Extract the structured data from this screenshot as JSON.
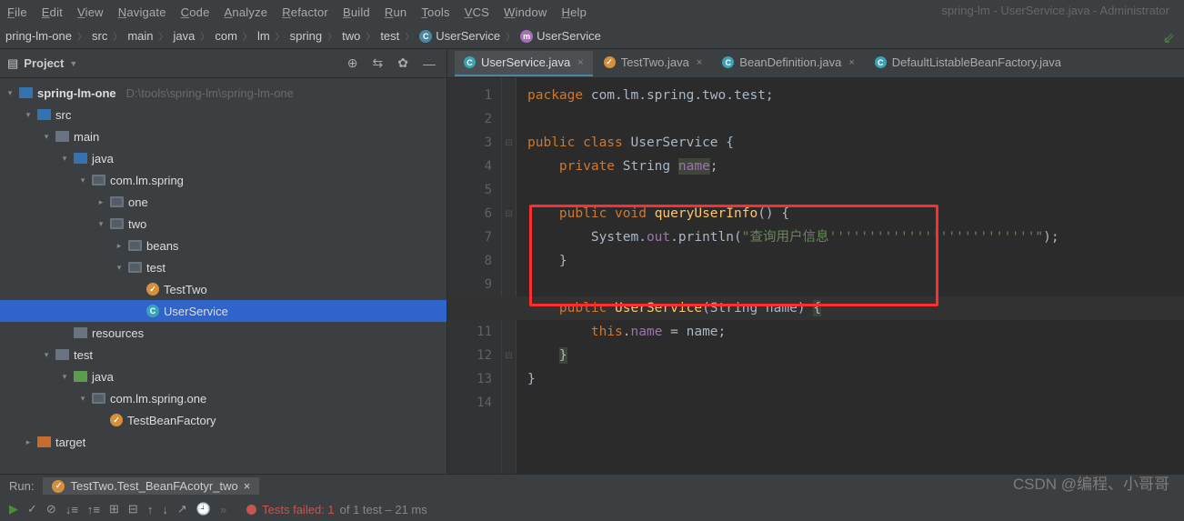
{
  "title": "spring-lm - UserService.java - Administrator",
  "menu": [
    "File",
    "Edit",
    "View",
    "Navigate",
    "Code",
    "Analyze",
    "Refactor",
    "Build",
    "Run",
    "Tools",
    "VCS",
    "Window",
    "Help"
  ],
  "breadcrumbs": [
    {
      "label": "pring-lm-one"
    },
    {
      "label": "src"
    },
    {
      "label": "main"
    },
    {
      "label": "java"
    },
    {
      "label": "com"
    },
    {
      "label": "lm"
    },
    {
      "label": "spring"
    },
    {
      "label": "two"
    },
    {
      "label": "test"
    },
    {
      "label": "UserService",
      "icon": "cyan"
    },
    {
      "label": "UserService",
      "icon": "purple"
    }
  ],
  "sidebar": {
    "title": "Project",
    "root": {
      "label": "spring-lm-one",
      "path": "D:\\tools\\spring-lm\\spring-lm-one"
    },
    "tree": [
      {
        "indent": 1,
        "arrow": "d",
        "icon": "folder-blue",
        "label": "src"
      },
      {
        "indent": 2,
        "arrow": "d",
        "icon": "folder",
        "label": "main"
      },
      {
        "indent": 3,
        "arrow": "d",
        "icon": "folder-blue",
        "label": "java"
      },
      {
        "indent": 4,
        "arrow": "d",
        "icon": "folder-pkg",
        "label": "com.lm.spring"
      },
      {
        "indent": 5,
        "arrow": "r",
        "icon": "folder-pkg",
        "label": "one"
      },
      {
        "indent": 5,
        "arrow": "d",
        "icon": "folder-pkg",
        "label": "two"
      },
      {
        "indent": 6,
        "arrow": "r",
        "icon": "folder-pkg",
        "label": "beans"
      },
      {
        "indent": 6,
        "arrow": "d",
        "icon": "folder-pkg",
        "label": "test"
      },
      {
        "indent": 7,
        "arrow": "",
        "icon": "file-orange",
        "label": "TestTwo"
      },
      {
        "indent": 7,
        "arrow": "",
        "icon": "file-cyan",
        "label": "UserService",
        "selected": true
      },
      {
        "indent": 3,
        "arrow": "",
        "icon": "folder",
        "label": "resources"
      },
      {
        "indent": 2,
        "arrow": "d",
        "icon": "folder",
        "label": "test"
      },
      {
        "indent": 3,
        "arrow": "d",
        "icon": "folder-green",
        "label": "java"
      },
      {
        "indent": 4,
        "arrow": "d",
        "icon": "folder-pkg",
        "label": "com.lm.spring.one"
      },
      {
        "indent": 5,
        "arrow": "",
        "icon": "file-orange",
        "label": "TestBeanFactory"
      },
      {
        "indent": 1,
        "arrow": "r",
        "icon": "folder-orange",
        "label": "target"
      }
    ]
  },
  "tabs": [
    {
      "label": "UserService.java",
      "active": true,
      "icon": "cyan"
    },
    {
      "label": "TestTwo.java",
      "active": false,
      "icon": "orange"
    },
    {
      "label": "BeanDefinition.java",
      "active": false,
      "icon": "cyan"
    },
    {
      "label": "DefaultListableBeanFactory.java",
      "active": false,
      "icon": "cyan",
      "noclose": true
    }
  ],
  "code": {
    "lines": [
      {
        "tokens": [
          {
            "t": "package ",
            "c": "kw"
          },
          {
            "t": "com.lm.spring.two.test;",
            "c": "typ"
          }
        ]
      },
      {
        "tokens": []
      },
      {
        "tokens": [
          {
            "t": "public class ",
            "c": "kw"
          },
          {
            "t": "UserService ",
            "c": "typ"
          },
          {
            "t": "{",
            "c": "typ"
          }
        ]
      },
      {
        "tokens": [
          {
            "t": "    ",
            "c": ""
          },
          {
            "t": "private ",
            "c": "kw"
          },
          {
            "t": "String ",
            "c": "typ"
          },
          {
            "t": "name",
            "c": "high fld"
          },
          {
            "t": ";",
            "c": "typ"
          }
        ]
      },
      {
        "tokens": []
      },
      {
        "tokens": [
          {
            "t": "    ",
            "c": ""
          },
          {
            "t": "public void ",
            "c": "kw"
          },
          {
            "t": "queryUserInfo",
            "c": "id"
          },
          {
            "t": "() {",
            "c": "typ"
          }
        ]
      },
      {
        "tokens": [
          {
            "t": "        System.",
            "c": "typ"
          },
          {
            "t": "out",
            "c": "fld"
          },
          {
            "t": ".println(",
            "c": "typ"
          },
          {
            "t": "\"查询用户信息''''''''''''''''''''''''''\"",
            "c": "str"
          },
          {
            "t": ");",
            "c": "typ"
          }
        ]
      },
      {
        "tokens": [
          {
            "t": "    }",
            "c": "typ"
          }
        ]
      },
      {
        "tokens": []
      },
      {
        "tokens": [
          {
            "t": "    ",
            "c": ""
          },
          {
            "t": "public ",
            "c": "kw"
          },
          {
            "t": "UserService",
            "c": "id"
          },
          {
            "t": "(String name) ",
            "c": "typ"
          },
          {
            "t": "{",
            "c": "high typ"
          }
        ]
      },
      {
        "tokens": [
          {
            "t": "        ",
            "c": ""
          },
          {
            "t": "this",
            "c": "this"
          },
          {
            "t": ".",
            "c": "typ"
          },
          {
            "t": "name ",
            "c": "fld"
          },
          {
            "t": "= name;",
            "c": "typ"
          }
        ]
      },
      {
        "tokens": [
          {
            "t": "    ",
            "c": ""
          },
          {
            "t": "}",
            "c": "high typ"
          }
        ]
      },
      {
        "tokens": [
          {
            "t": "}",
            "c": "typ"
          }
        ]
      },
      {
        "tokens": []
      }
    ]
  },
  "run": {
    "label": "Run:",
    "tab": "TestTwo.Test_BeanFAcotyr_two",
    "fail_text": "Tests failed: 1",
    "fail_tail": "of 1 test – 21 ms"
  },
  "watermark": "CSDN @编程、小哥哥"
}
